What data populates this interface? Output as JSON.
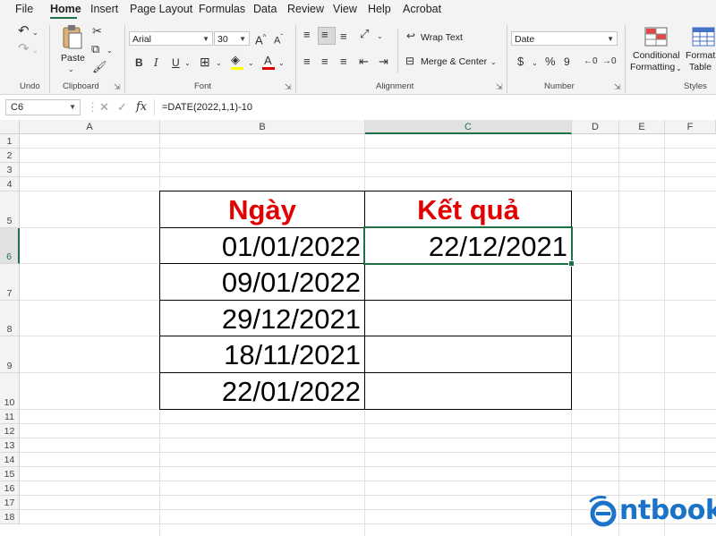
{
  "menu": {
    "items": [
      "File",
      "Home",
      "Insert",
      "Page Layout",
      "Formulas",
      "Data",
      "Review",
      "View",
      "Help",
      "Acrobat"
    ],
    "active": "Home"
  },
  "ribbon": {
    "groups": {
      "undo": "Undo",
      "clipboard": "Clipboard",
      "font": "Font",
      "alignment": "Alignment",
      "number": "Number",
      "styles": "Styles"
    },
    "paste_label": "Paste",
    "font_name": "Arial",
    "font_size": "30",
    "wrap_text": "Wrap Text",
    "merge_center": "Merge & Center",
    "number_format": "Date",
    "conditional_formatting": [
      "Conditional",
      "Formatting"
    ],
    "format_table": [
      "Format",
      "Table"
    ],
    "bold": "B",
    "italic": "I",
    "underline": "U",
    "font_color_letter": "A",
    "currency_symbol": "$",
    "percent_symbol": "%",
    "comma_symbol": "9",
    "accent_color": "#1e7145"
  },
  "formula_bar": {
    "name_box": "C6",
    "fx_label": "fx",
    "formula": "=DATE(2022,1,1)-10"
  },
  "sheet": {
    "columns": [
      "A",
      "B",
      "C",
      "D",
      "E",
      "F"
    ],
    "rows": [
      "1",
      "2",
      "3",
      "4",
      "5",
      "6",
      "7",
      "8",
      "9",
      "10",
      "11",
      "12",
      "13",
      "14",
      "15",
      "16",
      "17",
      "18"
    ],
    "selected_cell": "C6",
    "header_color": "#e00000",
    "table": {
      "header": [
        "Ngày",
        "Kết quả"
      ],
      "rows": [
        [
          "01/01/2022",
          "22/12/2021"
        ],
        [
          "09/01/2022",
          ""
        ],
        [
          "29/12/2021",
          ""
        ],
        [
          "18/11/2021",
          ""
        ],
        [
          "22/01/2022",
          ""
        ]
      ]
    }
  },
  "logo": {
    "text": "ntbook",
    "color": "#1a73c9"
  }
}
